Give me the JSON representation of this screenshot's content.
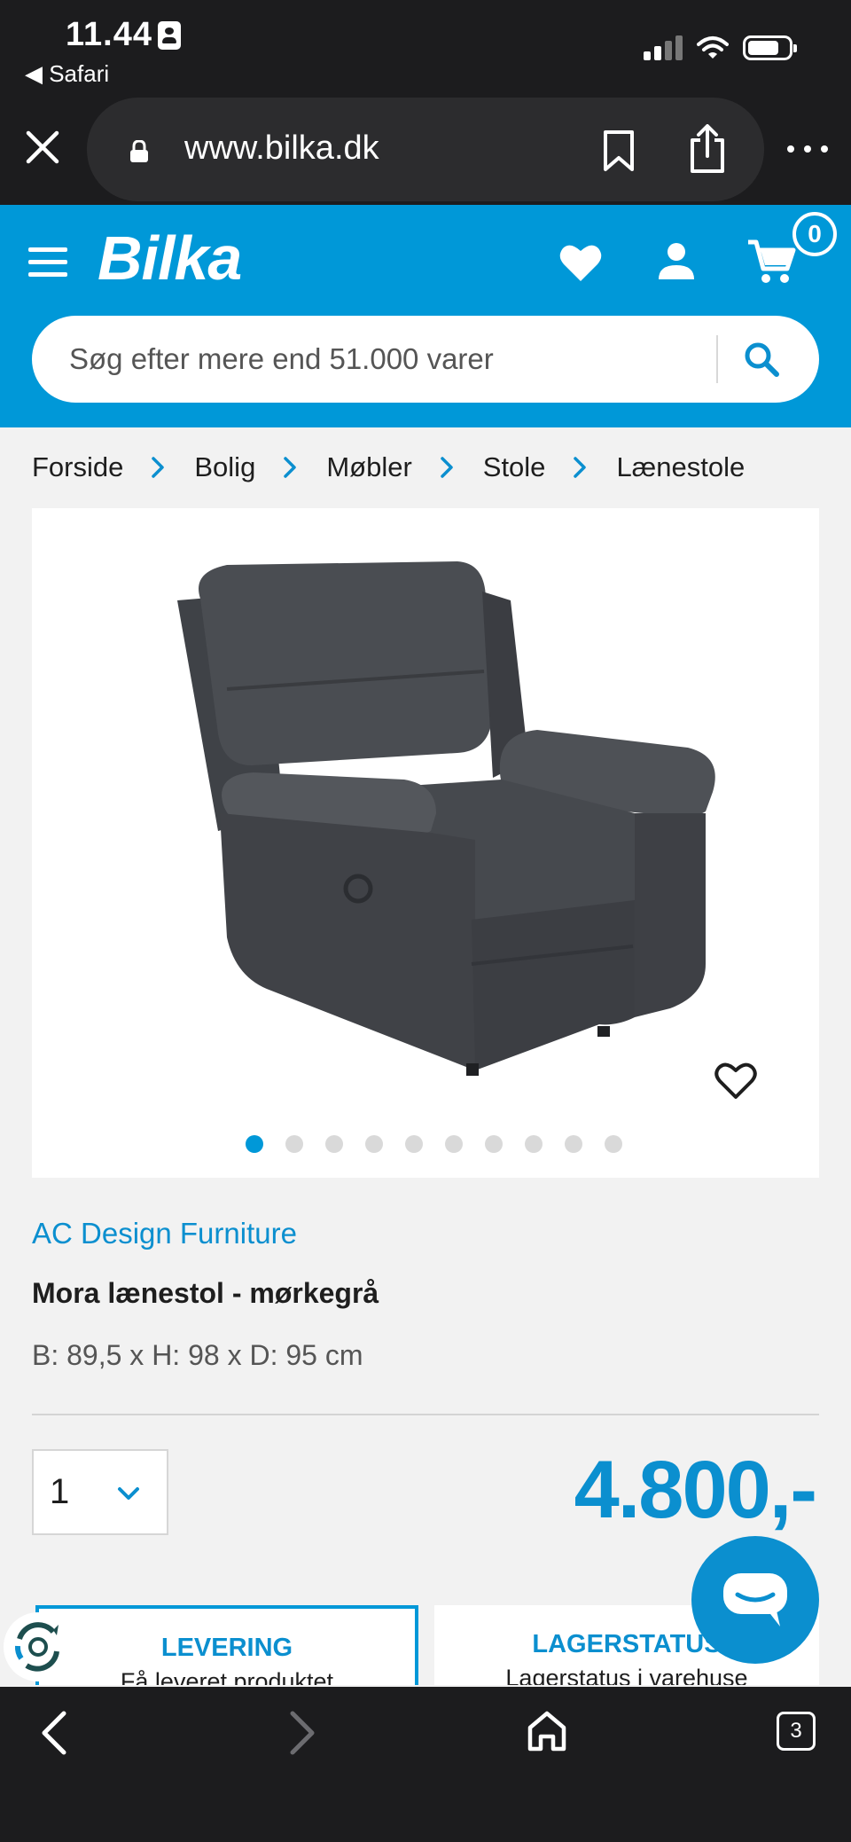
{
  "status_bar": {
    "time": "11.44",
    "back_app": "◀ Safari"
  },
  "browser": {
    "url": "www.bilka.dk",
    "tab_count": "3"
  },
  "header": {
    "logo": "Bilka",
    "cart_count": "0",
    "search_placeholder": "Søg efter mere end 51.000 varer",
    "brand_color": "#0098d8"
  },
  "breadcrumb": [
    "Forside",
    "Bolig",
    "Møbler",
    "Stole",
    "Lænestole"
  ],
  "gallery": {
    "image_count": 10,
    "active_index": 0
  },
  "product": {
    "brand": "AC Design Furniture",
    "title": "Mora lænestol - mørkegrå",
    "dimensions": "B: 89,5 x H: 98 x D: 95 cm",
    "quantity": "1",
    "price": "4.800,-"
  },
  "cards": {
    "delivery": {
      "title": "LEVERING",
      "subtitle": "Få leveret produktet"
    },
    "stock": {
      "title": "LAGERSTATUS",
      "subtitle": "Lagerstatus i varehuse"
    }
  },
  "icons": [
    "badge-icon",
    "signal-icon",
    "wifi-icon",
    "battery-icon",
    "close-icon",
    "lock-icon",
    "bookmark-icon",
    "share-icon",
    "more-icon",
    "menu-icon",
    "heart-icon",
    "user-icon",
    "cart-icon",
    "search-icon",
    "chevron-right-icon",
    "chevron-down-icon",
    "recycle-icon",
    "chat-icon",
    "back-icon",
    "forward-icon",
    "home-icon"
  ]
}
